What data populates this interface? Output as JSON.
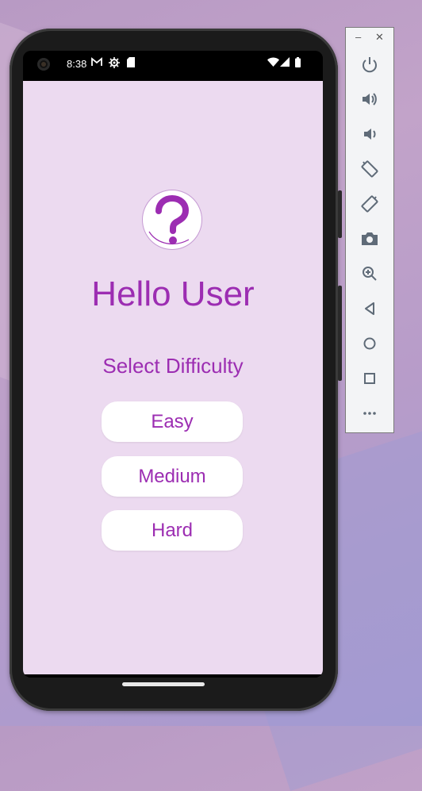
{
  "status_bar": {
    "time": "8:38",
    "icons": [
      "camera-icon",
      "gmail-icon",
      "settings-icon",
      "sd-card-icon",
      "wifi-icon",
      "cellular-icon",
      "battery-icon"
    ]
  },
  "app": {
    "greeting": "Hello User",
    "select_label": "Select Difficulty",
    "difficulties": [
      "Easy",
      "Medium",
      "Hard"
    ],
    "logo_icon": "question-mark-icon",
    "accent_color": "#9c2db2",
    "background_color": "#ecdaf0"
  },
  "emulator_toolbar": {
    "window_controls": [
      "minimize-icon",
      "close-icon"
    ],
    "buttons": [
      "power-icon",
      "volume-up-icon",
      "volume-down-icon",
      "rotate-left-icon",
      "rotate-right-icon",
      "camera-icon",
      "zoom-icon",
      "back-icon",
      "home-icon",
      "overview-icon",
      "more-icon"
    ]
  }
}
